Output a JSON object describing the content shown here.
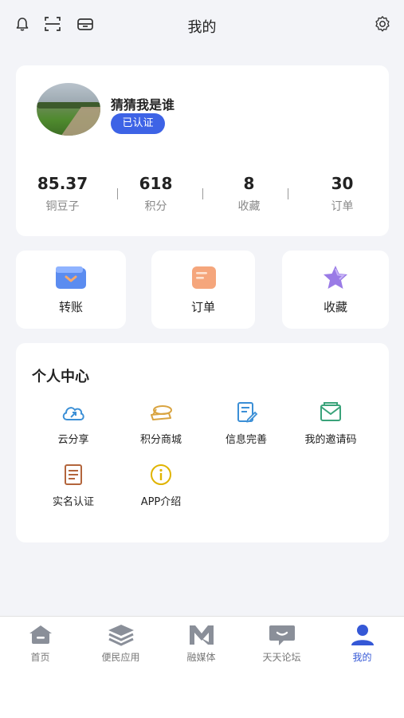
{
  "header": {
    "title": "我的",
    "icons": [
      "bell-icon",
      "scan-icon",
      "inbox-icon",
      "settings-icon"
    ]
  },
  "profile": {
    "username": "猜猜我是谁",
    "badge": "已认证",
    "stats": [
      {
        "value": "85.37",
        "label": "铜豆子"
      },
      {
        "value": "618",
        "label": "积分"
      },
      {
        "value": "8",
        "label": "收藏"
      },
      {
        "value": "30",
        "label": "订单"
      }
    ]
  },
  "quick_actions": [
    {
      "label": "转账",
      "icon": "wallet-icon"
    },
    {
      "label": "订单",
      "icon": "order-icon"
    },
    {
      "label": "收藏",
      "icon": "star-icon"
    }
  ],
  "personal_center": {
    "title": "个人中心",
    "items": [
      {
        "label": "云分享",
        "icon": "cloud-share-icon"
      },
      {
        "label": "积分商城",
        "icon": "coins-icon"
      },
      {
        "label": "信息完善",
        "icon": "edit-doc-icon"
      },
      {
        "label": "我的邀请码",
        "icon": "mail-icon"
      },
      {
        "label": "实名认证",
        "icon": "id-doc-icon"
      },
      {
        "label": "APP介绍",
        "icon": "info-icon"
      }
    ]
  },
  "tabbar": {
    "tabs": [
      {
        "label": "首页",
        "icon": "home-icon"
      },
      {
        "label": "便民应用",
        "icon": "layers-icon"
      },
      {
        "label": "融媒体",
        "icon": "media-icon"
      },
      {
        "label": "天天论坛",
        "icon": "forum-icon"
      },
      {
        "label": "我的",
        "icon": "user-icon"
      }
    ],
    "active": "我的"
  },
  "colors": {
    "accent": "#3d63e6",
    "background": "#f3f4f8",
    "tab_inactive": "#777777",
    "tab_active": "#3558d6"
  }
}
